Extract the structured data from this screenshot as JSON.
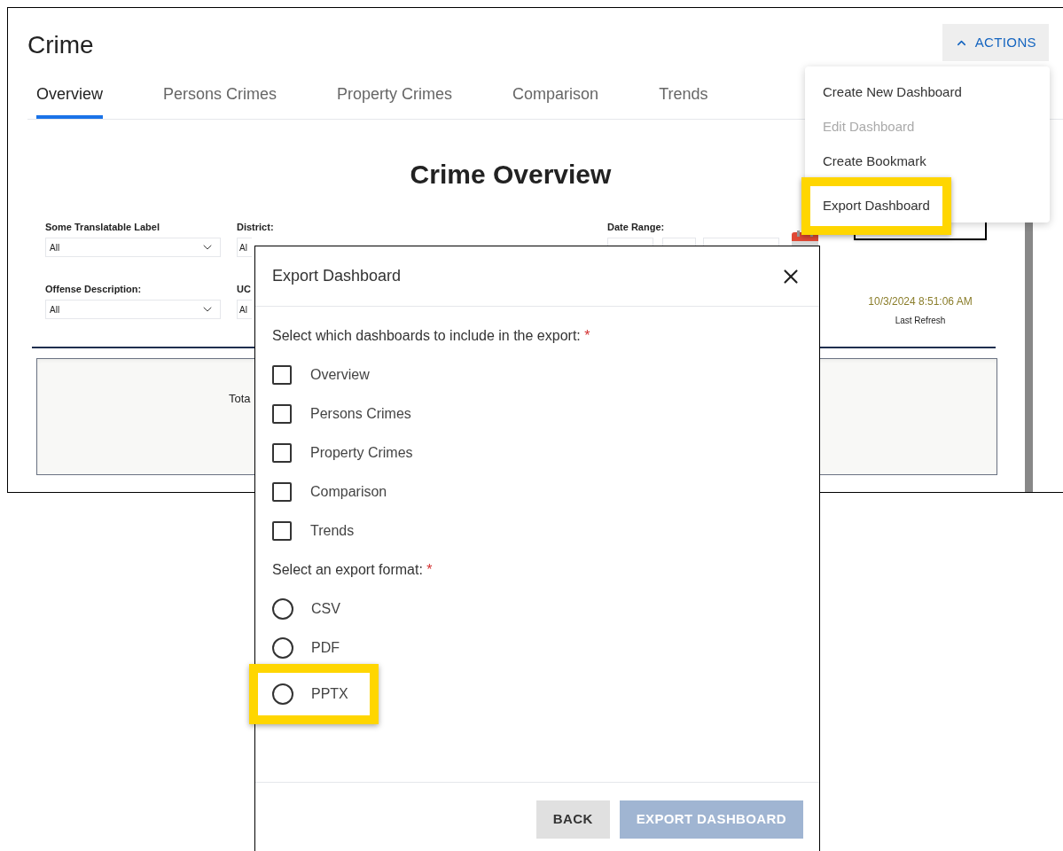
{
  "header": {
    "title": "Crime",
    "actions_button": {
      "label": "ACTIONS",
      "expanded": true
    }
  },
  "tabs": [
    {
      "label": "Overview",
      "selected": true
    },
    {
      "label": "Persons Crimes",
      "selected": false
    },
    {
      "label": "Property Crimes",
      "selected": false
    },
    {
      "label": "Comparison",
      "selected": false
    },
    {
      "label": "Trends",
      "selected": false
    }
  ],
  "actions_menu": [
    {
      "label": "Create New Dashboard",
      "disabled": false,
      "highlighted": false
    },
    {
      "label": "Edit Dashboard",
      "disabled": true,
      "highlighted": false
    },
    {
      "label": "Create Bookmark",
      "disabled": false,
      "highlighted": false
    },
    {
      "label": "Export Dashboard",
      "disabled": false,
      "highlighted": true
    }
  ],
  "report": {
    "title": "Crime Overview",
    "filters": [
      {
        "label": "Some Translatable Label",
        "value": "All"
      },
      {
        "label": "District:",
        "value": "Al"
      },
      {
        "label": "Offense Description:",
        "value": "All"
      },
      {
        "label": "UC",
        "value": "Al"
      }
    ],
    "date_range_label": "Date Range:",
    "refresh_time": "10/3/2024 8:51:06 AM",
    "refresh_label": "Last Refresh",
    "card_text": "Tota"
  },
  "dialog": {
    "title": "Export Dashboard",
    "dashboards_prompt": {
      "text": "Select which dashboards to include in the export:",
      "required_mark": "*"
    },
    "dashboards": [
      {
        "label": "Overview",
        "checked": false
      },
      {
        "label": "Persons Crimes",
        "checked": false
      },
      {
        "label": "Property Crimes",
        "checked": false
      },
      {
        "label": "Comparison",
        "checked": false
      },
      {
        "label": "Trends",
        "checked": false
      }
    ],
    "format_prompt": {
      "text": "Select an export format:",
      "required_mark": "*"
    },
    "formats": [
      {
        "label": "CSV",
        "selected": false,
        "highlighted": false
      },
      {
        "label": "PDF",
        "selected": false,
        "highlighted": false
      },
      {
        "label": "PPTX",
        "selected": false,
        "highlighted": true
      }
    ],
    "buttons": [
      {
        "label": "BACK",
        "kind": "secondary",
        "disabled": false
      },
      {
        "label": "EXPORT DASHBOARD",
        "kind": "primary",
        "disabled": true
      }
    ]
  }
}
